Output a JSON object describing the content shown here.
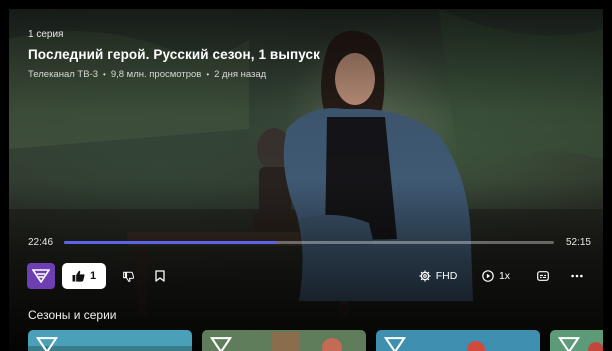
{
  "video": {
    "episode_label": "1 серия",
    "title": "Последний герой. Русский сезон, 1 выпуск",
    "channel": "Телеканал ТВ-3",
    "views": "9,8 млн. просмотров",
    "published": "2 дня назад",
    "separator": "•"
  },
  "player": {
    "current_time": "22:46",
    "duration": "52:15",
    "progress_fraction": 0.4357,
    "accent_color": "#5b63e8"
  },
  "controls": {
    "channel_logo_icon": "tv3-logo-icon",
    "like_count": "1",
    "like_icon": "thumbs-up-icon",
    "dislike_icon": "thumbs-down-icon",
    "bookmark_icon": "bookmark-icon",
    "quality_label": "FHD",
    "quality_icon": "gear-icon",
    "speed_label": "1x",
    "speed_icon": "play-circle-icon",
    "subtitles_icon": "subtitles-icon",
    "more_icon": "more-horizontal-icon",
    "brand_color": "#6e3fb3"
  },
  "seasons": {
    "title": "Сезоны и серии",
    "thumbnails": [
      {
        "badge_icon": "tv3-logo-icon",
        "tint": "#4aa0b8"
      },
      {
        "badge_icon": "tv3-logo-icon",
        "tint": "#5f7d5a"
      },
      {
        "badge_icon": "tv3-logo-icon",
        "tint": "#3e8fb0"
      },
      {
        "badge_icon": "tv3-logo-icon",
        "tint": "#5c9a78"
      }
    ]
  }
}
